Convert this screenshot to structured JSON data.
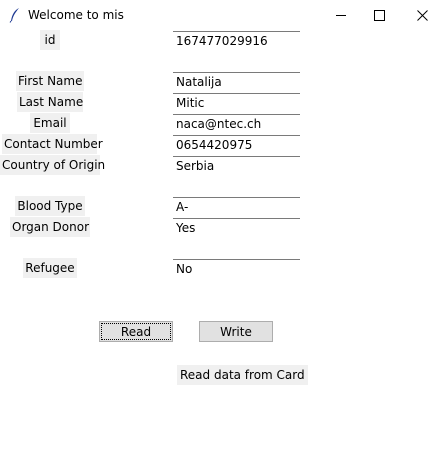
{
  "window": {
    "title": "Welcome to mis",
    "minimize_glyph": "—",
    "close_glyph": "✕"
  },
  "form": {
    "id": {
      "label": "id",
      "value": "167477029916"
    },
    "first_name": {
      "label": "First Name",
      "value": "Natalija"
    },
    "last_name": {
      "label": "Last Name",
      "value": "Mitic"
    },
    "email": {
      "label": "Email",
      "value": "naca@ntec.ch"
    },
    "contact_number": {
      "label": "Contact Number",
      "value": "0654420975"
    },
    "country_of_origin": {
      "label": "Country of Origin",
      "value": "Serbia"
    },
    "blood_type": {
      "label": "Blood Type",
      "value": "A-"
    },
    "organ_donor": {
      "label": "Organ Donor",
      "value": "Yes"
    },
    "refugee": {
      "label": "Refugee",
      "value": "No"
    }
  },
  "buttons": {
    "read": "Read",
    "write": "Write"
  },
  "status": "Read data from Card"
}
